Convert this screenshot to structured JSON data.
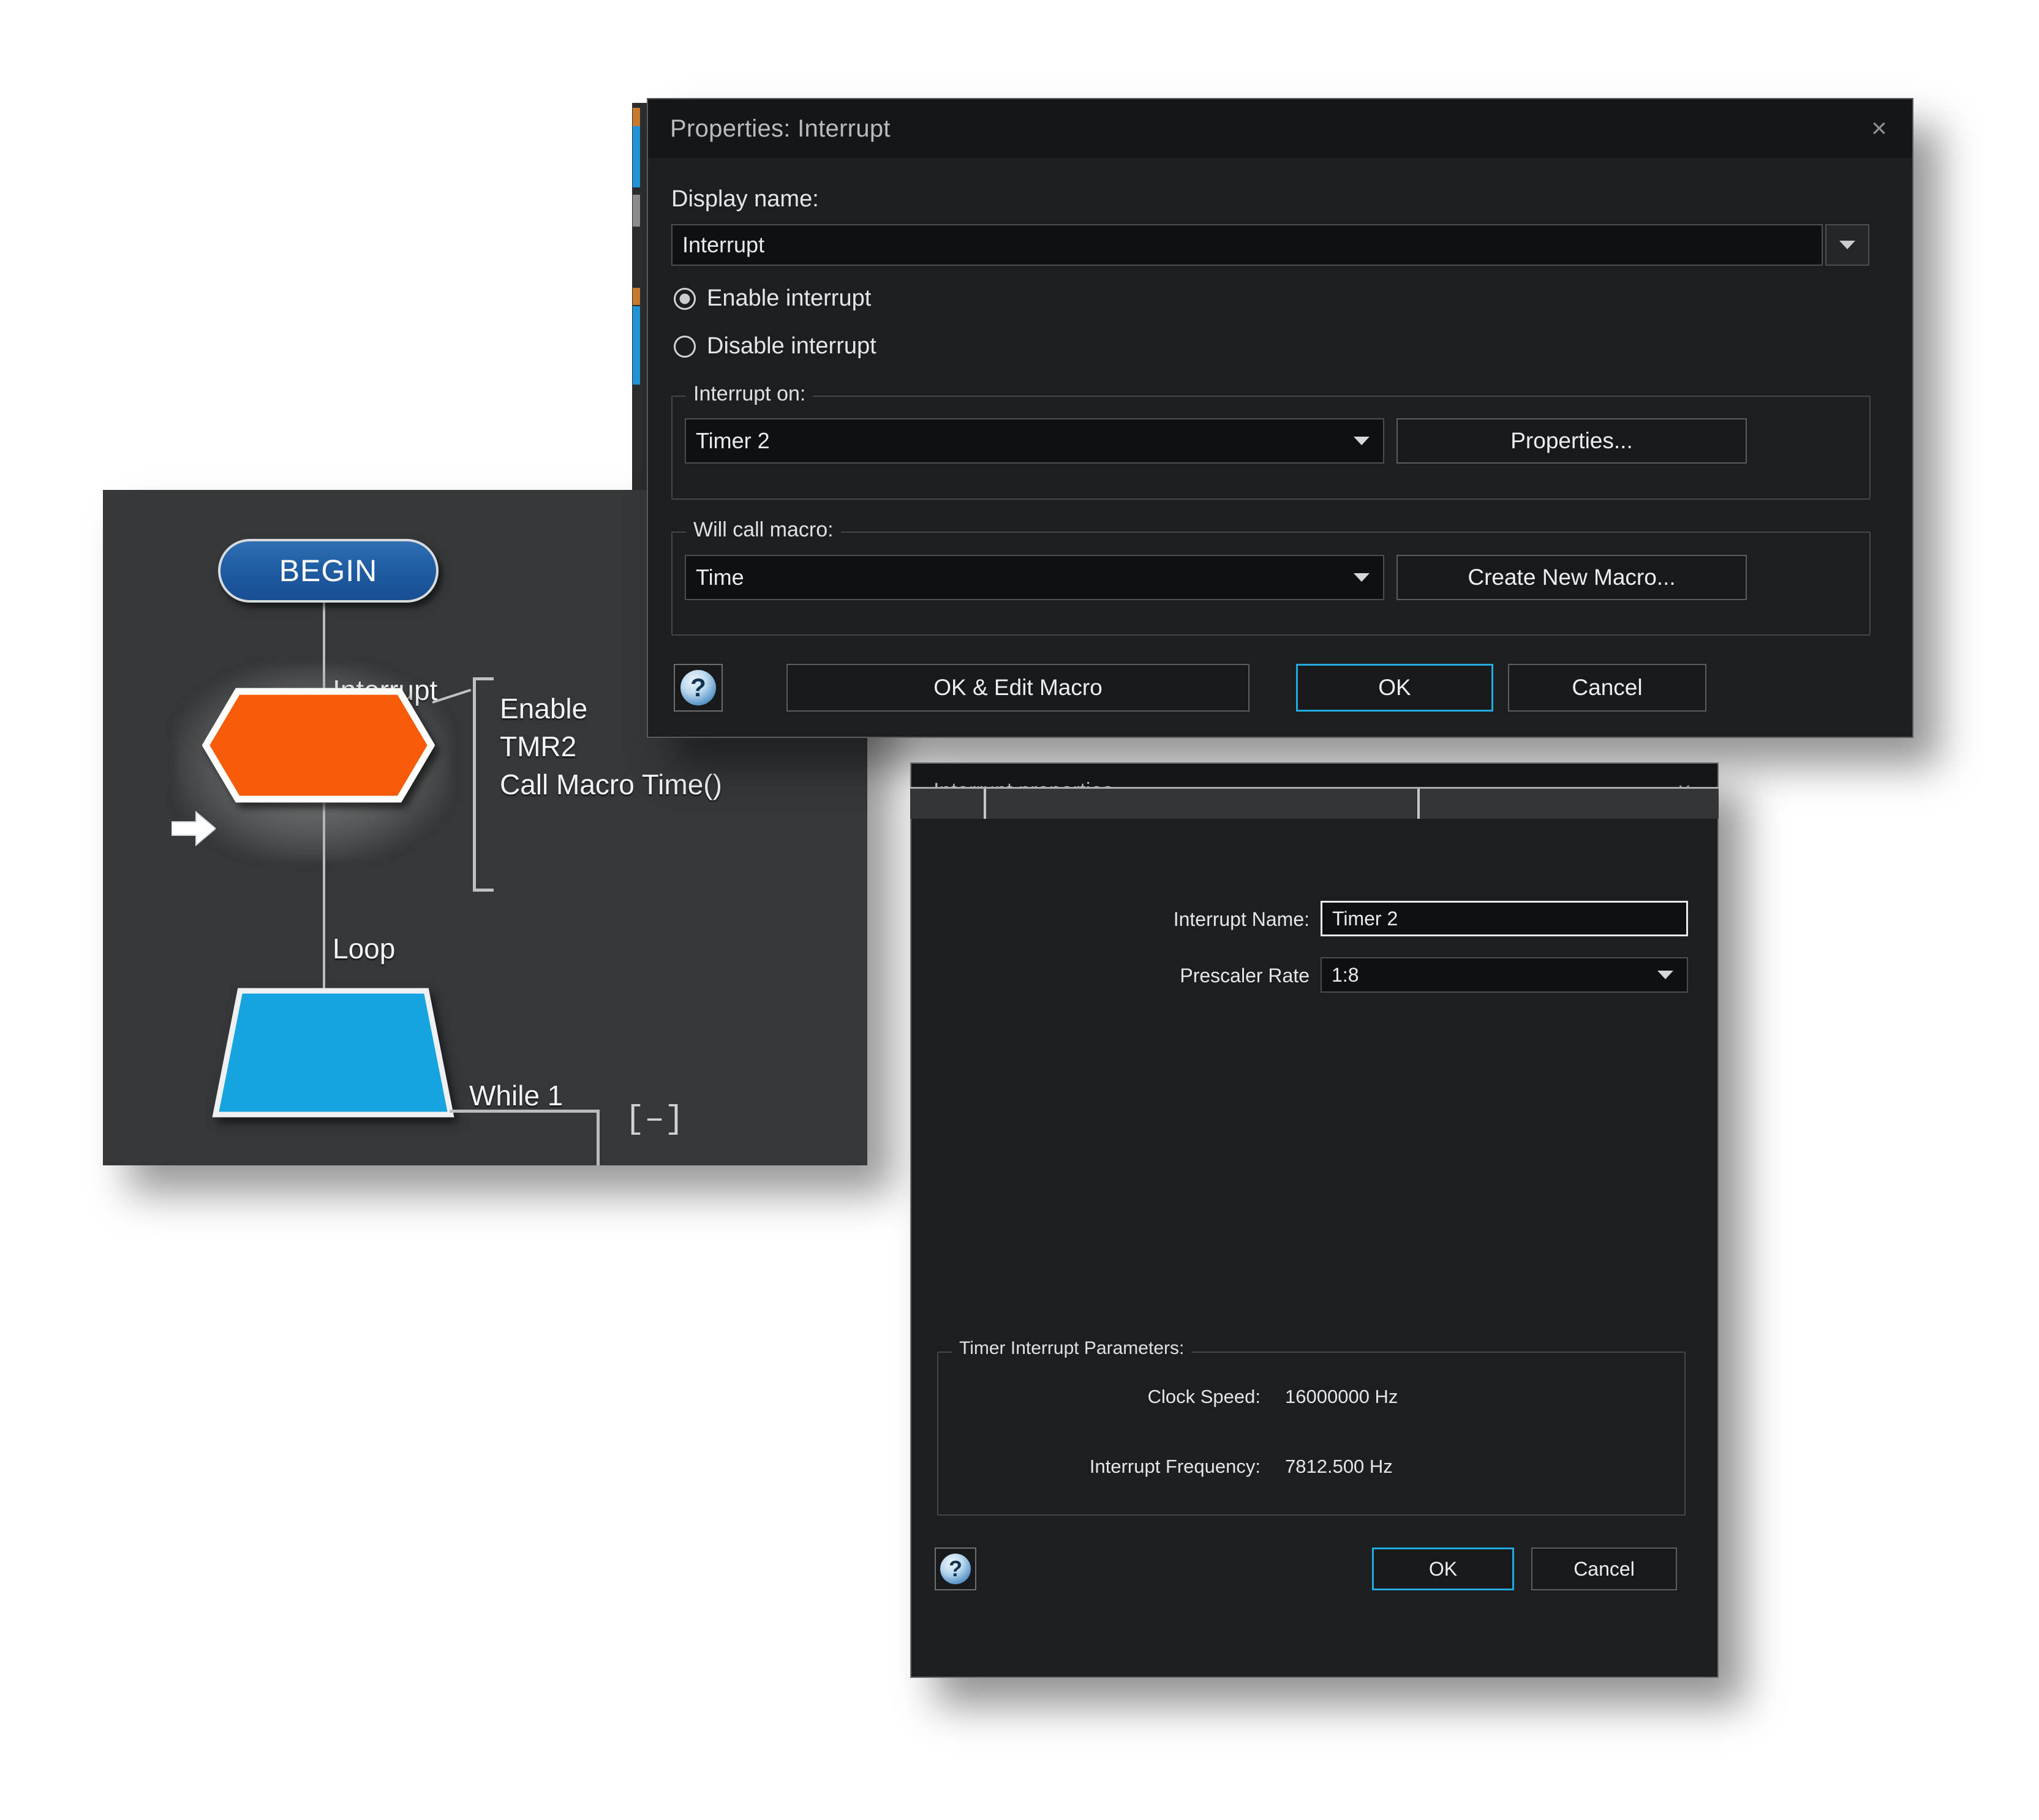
{
  "flowchart_panel": {
    "begin_label": "BEGIN",
    "interrupt_connector_label": "Interrupt",
    "interrupt_annotation_lines": [
      "Enable",
      "TMR2",
      "Call Macro Time()"
    ],
    "loop_connector_label": "Loop",
    "loop_condition_label": "While 1",
    "collapse_toggle_label": "[–]",
    "colors": {
      "panel_bg": "#353739",
      "begin_node": "#1f5da4",
      "interrupt_node": "#f95c09",
      "loop_node": "#17a2e0"
    }
  },
  "dialog_interrupt": {
    "title": "Properties: Interrupt",
    "close_label": "×",
    "display_name_label": "Display name:",
    "display_name_value": "Interrupt",
    "radio_enable_label": "Enable interrupt",
    "radio_disable_label": "Disable interrupt",
    "radio_selected": "Enable interrupt",
    "group_interrupt_on_title": "Interrupt on:",
    "interrupt_on_value": "Timer 2",
    "properties_button": "Properties...",
    "group_will_call_macro_title": "Will call macro:",
    "will_call_macro_value": "Time",
    "create_new_macro_button": "Create New Macro...",
    "help_button_label": "?",
    "ok_edit_macro_button": "OK & Edit Macro",
    "ok_button": "OK",
    "cancel_button": "Cancel",
    "accent_color": "#23a8e0"
  },
  "dialog_interrupt_properties": {
    "title": "Interrupt properties",
    "close_label": "×",
    "interrupt_name_label": "Interrupt Name:",
    "interrupt_name_value": "Timer 2",
    "prescaler_rate_label": "Prescaler Rate",
    "prescaler_rate_value": "1:8",
    "group_timer_params_title": "Timer Interrupt Parameters:",
    "clock_speed_label": "Clock Speed:",
    "clock_speed_value": "16000000 Hz",
    "interrupt_frequency_label": "Interrupt Frequency:",
    "interrupt_frequency_value": "7812.500 Hz",
    "help_button_label": "?",
    "ok_button": "OK",
    "cancel_button": "Cancel",
    "accent_color": "#23a8e0"
  }
}
